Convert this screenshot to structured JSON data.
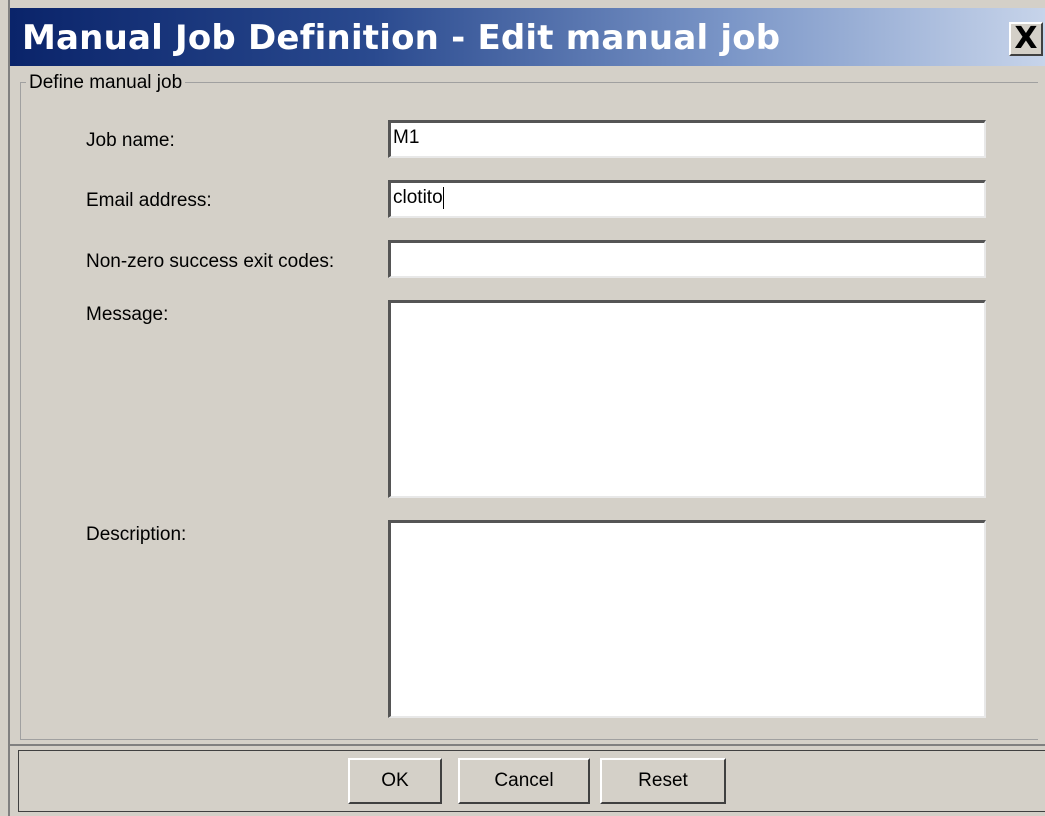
{
  "window": {
    "title": "Manual Job Definition - Edit manual job",
    "close_glyph": "X"
  },
  "group": {
    "legend": "Define manual job"
  },
  "form": {
    "job_name": {
      "label": "Job name:",
      "value": "M1"
    },
    "email": {
      "label": "Email address:",
      "value": "clotito"
    },
    "exit_codes": {
      "label": "Non-zero success exit codes:",
      "value": ""
    },
    "message": {
      "label": "Message:",
      "value": ""
    },
    "description": {
      "label": "Description:",
      "value": ""
    }
  },
  "buttons": {
    "ok": "OK",
    "cancel": "Cancel",
    "reset": "Reset"
  },
  "colors": {
    "dialog_bg": "#d4d0c8",
    "title_gradient_start": "#0a246a",
    "title_gradient_end": "#c7d4ea",
    "field_bg": "#ffffff"
  }
}
